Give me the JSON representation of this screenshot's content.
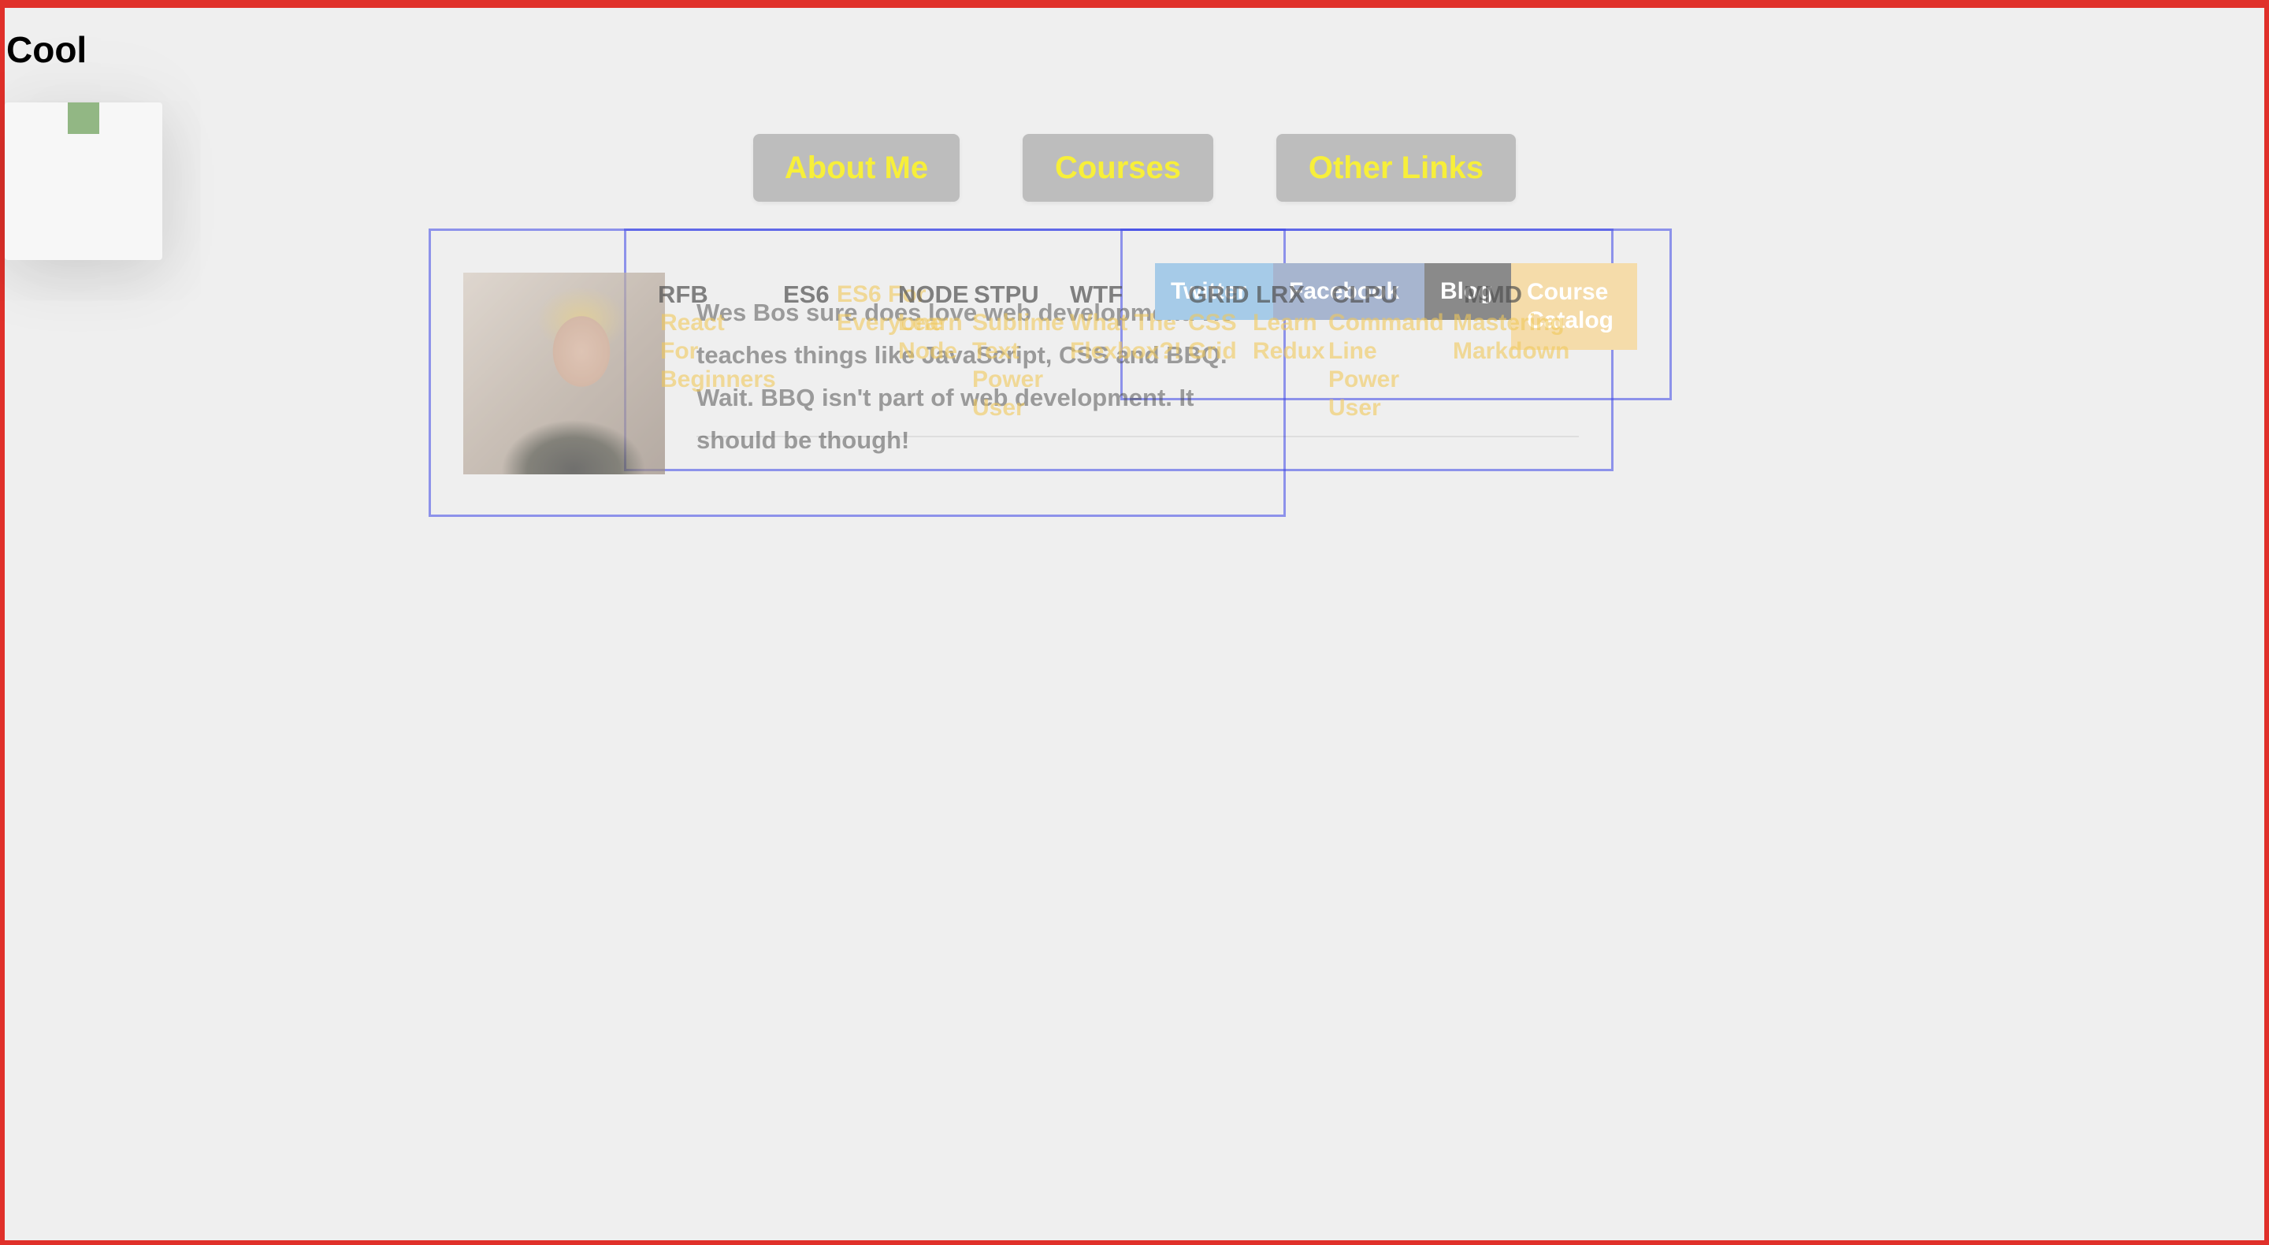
{
  "site": {
    "title": "Cool"
  },
  "nav": {
    "about": "About Me",
    "courses": "Courses",
    "links": "Other Links"
  },
  "about": {
    "bio": "Wes Bos sure does love web development. He teaches things like JavaScript, CSS and BBQ. Wait. BBQ isn't part of web development. It should be though!"
  },
  "courses": [
    {
      "code": "RFB",
      "title": "React For Beginners"
    },
    {
      "code": "ES6",
      "title": "ES6 For Everyone"
    },
    {
      "code": "NODE",
      "title": "Learn Node"
    },
    {
      "code": "STPU",
      "title": "Sublime Text Power User"
    },
    {
      "code": "WTF",
      "title": "What The Flexbox?!"
    },
    {
      "code": "GRID",
      "title": "CSS Grid"
    },
    {
      "code": "LRX",
      "title": "Learn Redux"
    },
    {
      "code": "CLPU",
      "title": "Command Line Power User"
    },
    {
      "code": "MMD",
      "title": "Mastering Markdown"
    }
  ],
  "links": [
    {
      "label": "Twitter",
      "color": "#a6cbe8"
    },
    {
      "label": "Facebook",
      "color": "#a7b5cf"
    },
    {
      "label": "Blog",
      "color": "#8a8a8a"
    },
    {
      "label": "Course Catalog",
      "color": "#f5dcaa"
    }
  ],
  "colors": {
    "frame": "#e0302a",
    "nav_text": "#f7ef3a",
    "nav_bg": "#bdbdbd",
    "menu_toggle": "#92b784",
    "dropdown_outline": "#3c46e6"
  }
}
